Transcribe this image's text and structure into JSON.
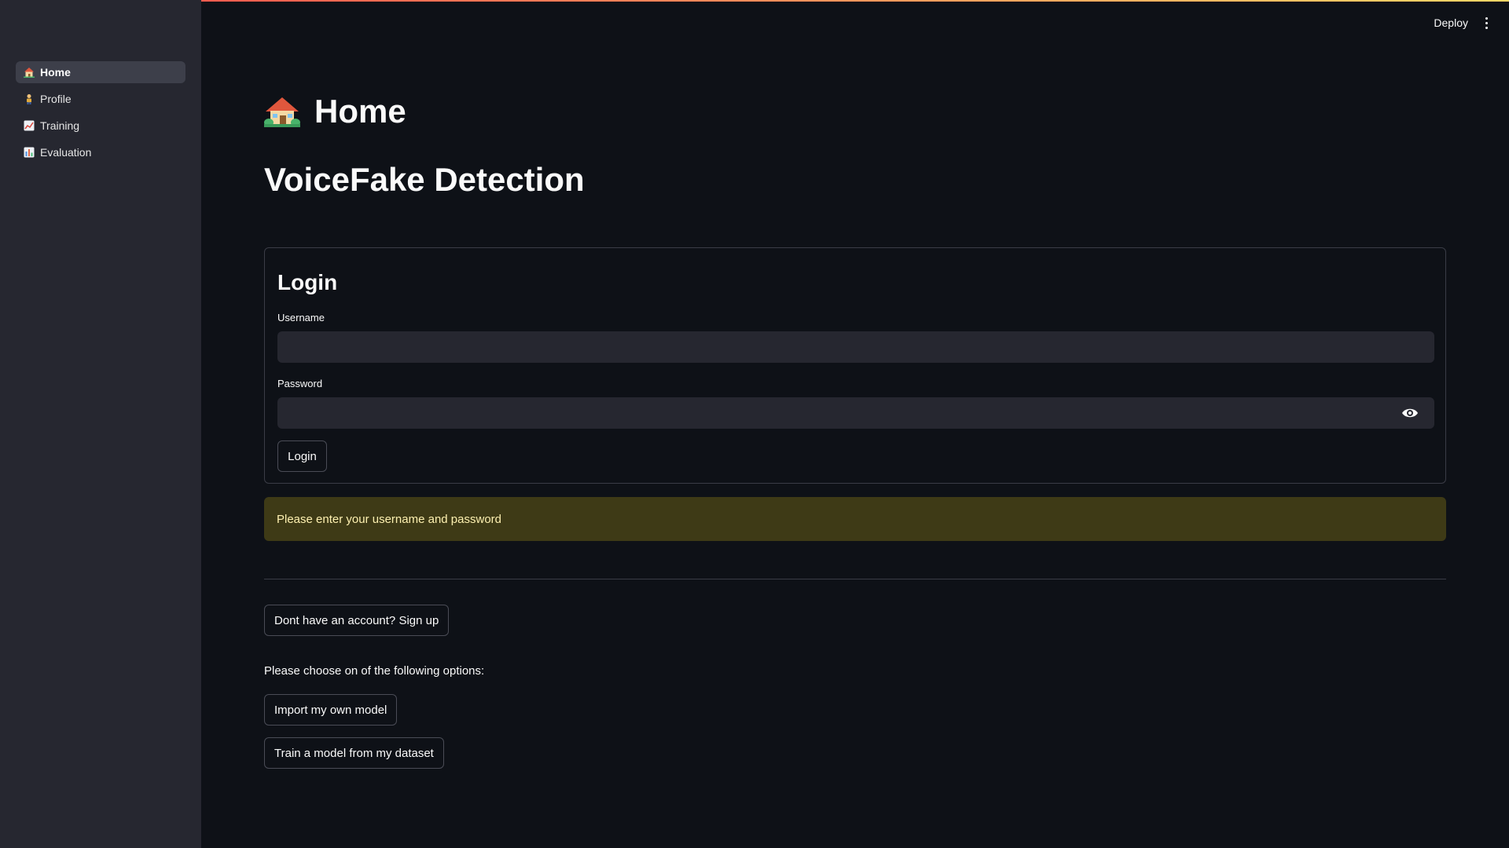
{
  "sidebar": {
    "items": [
      {
        "label": "Home",
        "icon": "house-icon",
        "active": true
      },
      {
        "label": "Profile",
        "icon": "person-icon",
        "active": false
      },
      {
        "label": "Training",
        "icon": "chart-increasing-icon",
        "active": false
      },
      {
        "label": "Evaluation",
        "icon": "bar-chart-icon",
        "active": false
      }
    ]
  },
  "toolbar": {
    "deploy_label": "Deploy",
    "menu_icon": "vertical-dots-icon"
  },
  "page": {
    "title": "Home",
    "app_title": "VoiceFake Detection"
  },
  "login_form": {
    "heading": "Login",
    "username_label": "Username",
    "username_value": "",
    "password_label": "Password",
    "password_value": "",
    "show_password_icon": "eye-icon",
    "submit_label": "Login"
  },
  "warning": {
    "text": "Please enter your username and password",
    "color": "#3e3a16"
  },
  "signup_label": "Dont have an account? Sign up",
  "options": {
    "prompt": "Please choose on of the following options:",
    "import_label": "Import my own model",
    "train_label": "Train a model from my dataset"
  },
  "colors": {
    "background": "#0e1117",
    "sidebar": "#262730",
    "input": "#262730",
    "accent_gradient": [
      "#ff4b4b",
      "#fdd766"
    ]
  }
}
